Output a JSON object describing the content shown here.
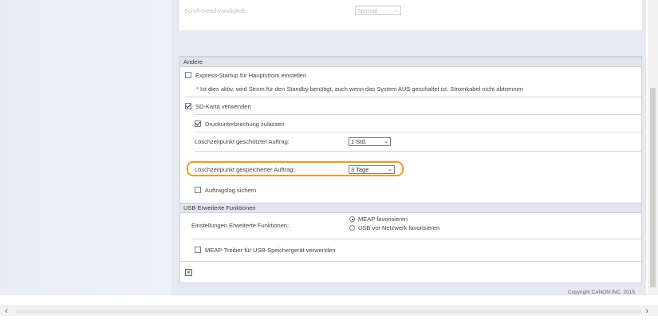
{
  "scroll_speed": {
    "label": "Scroll-Geschwindigkeit:",
    "value": "Normal"
  },
  "andere": {
    "header": "Andere",
    "express_startup": {
      "label": "Express-Startup für Hauptstrom einstellen",
      "checked": false
    },
    "express_note": "* Ist dies aktiv, wird Strom für den Standby benötigt, auch wenn das System AUS geschaltet ist. Stromkabel nicht abtrennen",
    "sd_card": {
      "label": "SD-Karta verwenden",
      "checked": true
    },
    "print_interrupt": {
      "label": "Druckunterbrechung zulassen",
      "checked": true
    },
    "delete_protected": {
      "label": "Löschzeitpunkt geschützter Auftrag:",
      "value": "1 Std."
    },
    "delete_stored": {
      "label": "Löschzeitpunkt gespeicherter Auftrag:",
      "value": "3 Tage"
    },
    "job_log": {
      "label": "Auftragslog sichern",
      "checked": false
    }
  },
  "usb": {
    "header": "USB Erweiterte Funktionen",
    "settings_label": "Einstellungen Erweiterte Funktionen:",
    "options": [
      "MEAP favorisieren",
      "USB vor Netzwerk favorisieren"
    ],
    "selected_index": 0,
    "meap_driver": {
      "label": "MEAP-Treiber für USB-Speichergerät verwenden",
      "checked": false
    }
  },
  "copyright": "Copyright CANON INC. 2015",
  "icons": {
    "reset": "reset-icon",
    "scroll_left": "arrow-left-icon",
    "scroll_right": "arrow-right-icon"
  }
}
